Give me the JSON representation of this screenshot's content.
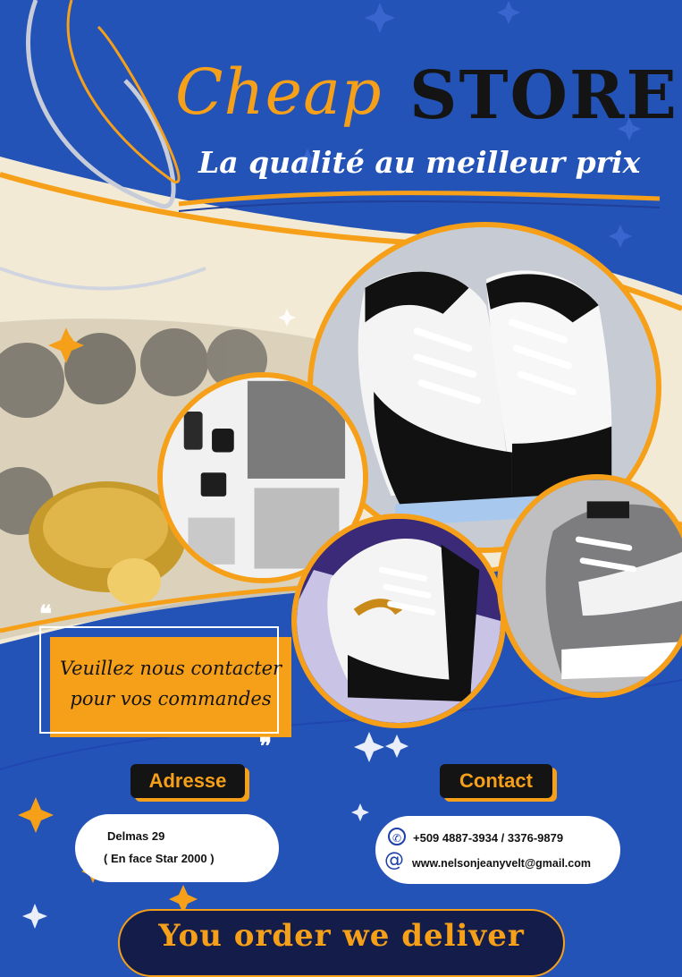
{
  "brand": {
    "title_part1": "Cheap",
    "title_part2": "STORE",
    "tagline": "La qualité au meilleur prix"
  },
  "promo": {
    "quote_open": "❝",
    "quote_close": "❞",
    "line1": "Veuillez nous contacter",
    "line2": "pour vos commandes"
  },
  "address": {
    "label": "Adresse",
    "line1": "Delmas 29",
    "line2": "( En face Star 2000 )"
  },
  "contact": {
    "label": "Contact",
    "phone_icon": "phone-icon",
    "phone": "+509 4887-3934 /  3376-9879",
    "email_icon": "at-sign-icon",
    "email": "www.nelsonjeanyvelt@gmail.com"
  },
  "banner": {
    "text": "You order we deliver"
  },
  "colors": {
    "background_blue": "#2453b8",
    "accent_orange": "#f6a019",
    "cream": "#f3ead5",
    "dark": "#141414"
  }
}
